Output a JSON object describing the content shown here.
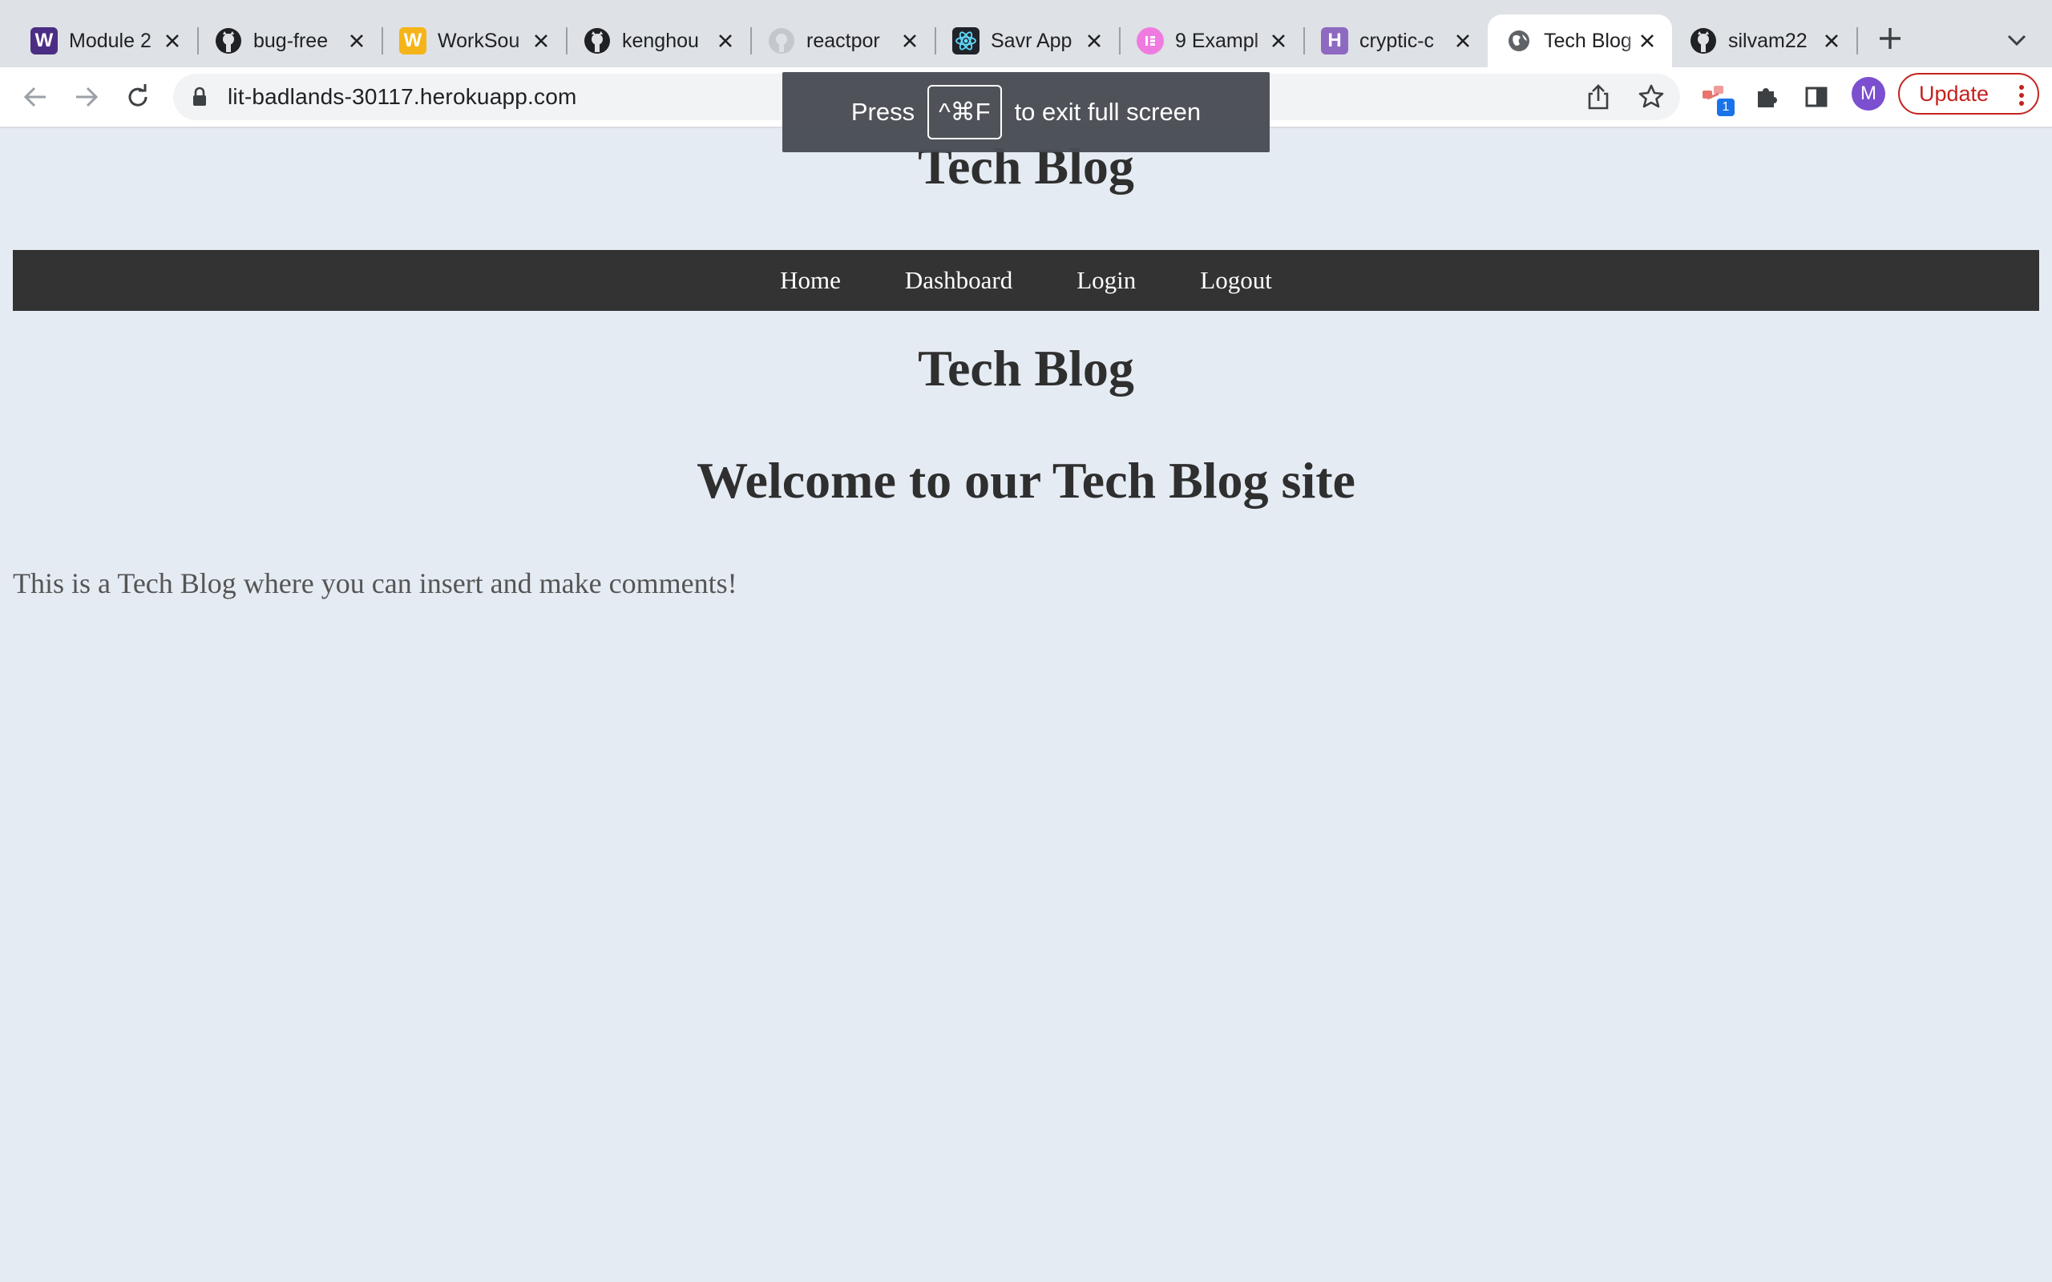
{
  "tabs": [
    {
      "title": "Module 2",
      "favicon": "W",
      "favicon_color": "#4b2e83",
      "active": false
    },
    {
      "title": "bug-free",
      "favicon": "github-icon",
      "active": false
    },
    {
      "title": "WorkSou",
      "favicon": "W",
      "favicon_color": "#f5b418",
      "active": false
    },
    {
      "title": "kenghou",
      "favicon": "github-icon",
      "active": false
    },
    {
      "title": "reactpor",
      "favicon": "github-icon",
      "active": false
    },
    {
      "title": "Savr App",
      "favicon": "react-icon",
      "active": false
    },
    {
      "title": "9 Exampl",
      "favicon": "elementor-icon",
      "favicon_color": "#f07be0",
      "active": false
    },
    {
      "title": "cryptic-c",
      "favicon": "heroku-icon",
      "favicon_color": "#8e69c1",
      "active": false
    },
    {
      "title": "Tech Blog",
      "favicon": "globe-icon",
      "active": true
    },
    {
      "title": "silvam22",
      "favicon": "github-icon",
      "active": false
    }
  ],
  "toolbar": {
    "url": "lit-badlands-30117.herokuapp.com",
    "extension_badge": "1",
    "profile_initial": "M",
    "update_label": "Update"
  },
  "fullscreen_toast": {
    "prefix": "Press",
    "key": "^⌘F",
    "suffix": "to exit full screen"
  },
  "page": {
    "header_title": "Tech Blog",
    "nav": [
      "Home",
      "Dashboard",
      "Login",
      "Logout"
    ],
    "title": "Tech Blog",
    "welcome": "Welcome to our Tech Blog site",
    "intro": "This is a Tech Blog where you can insert and make comments!"
  },
  "colors": {
    "page_background": "#e5ebf3",
    "navbar": "#333333",
    "update_accent": "#c5221f",
    "avatar": "#7b4fcf"
  }
}
